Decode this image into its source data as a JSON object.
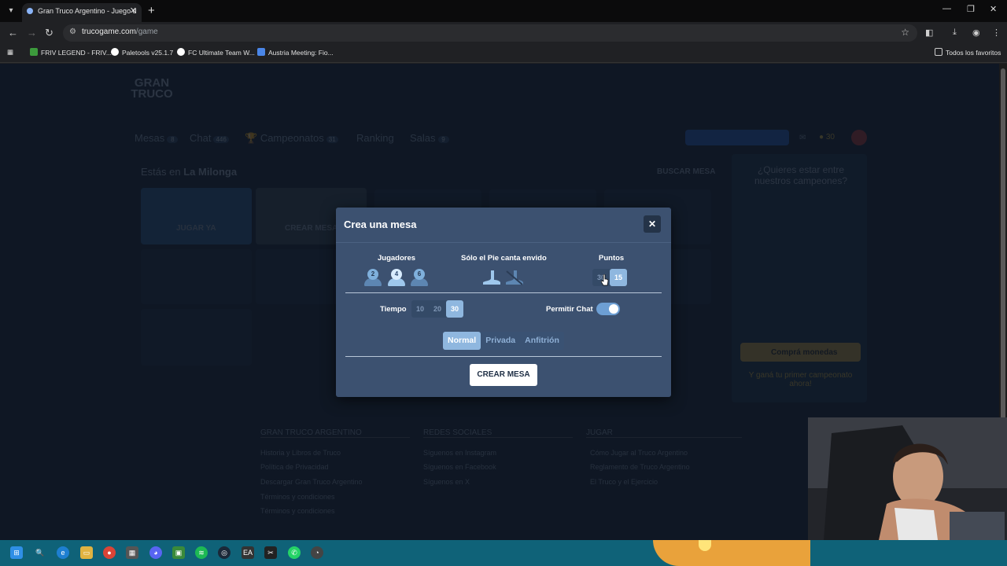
{
  "browser": {
    "tab_title": "Gran Truco Argentino - Juego d",
    "url_host": "trucogame.com",
    "url_path": "/game",
    "bookmarks": [
      "FRIV LEGEND - FRIV...",
      "Paletools v25.1.7",
      "FC Ultimate Team W...",
      "Austria Meeting: Fio..."
    ],
    "all_bookmarks": "Todos los favoritos"
  },
  "background": {
    "logo": "GRAN TRUCO",
    "nav": [
      {
        "label": "Mesas",
        "badge": "8"
      },
      {
        "label": "Chat",
        "badge": "446"
      },
      {
        "label": "Campeonatos",
        "badge": "31"
      },
      {
        "label": "Ranking",
        "badge": ""
      },
      {
        "label": "Salas",
        "badge": "9"
      }
    ],
    "location_prefix": "Estás en ",
    "location_name": "La Milonga",
    "search_table": "BUSCAR MESA",
    "play_now": "JUGAR YA",
    "create_table_bg": "CREAR MESA",
    "champions_title": "¿Quieres estar entre nuestros campeones?",
    "buy_coins": "Comprá monedas",
    "buy_sub": "Y ganá tu primer campeonato ahora!",
    "coins": "30",
    "footer_heads": [
      "GRAN TRUCO ARGENTINO",
      "REDES SOCIALES",
      "JUGAR"
    ],
    "footer_links": [
      [
        "Historia y Libros de Truco",
        "Política de Privacidad",
        "Descargar Gran Truco Argentino",
        "Términos y condiciones",
        "Términos y condiciones"
      ],
      [
        "Síguenos en Instagram",
        "Síguenos en Facebook",
        "Síguenos en X"
      ],
      [
        "Cómo Jugar al Truco Argentino",
        "Reglamento de Truco Argentino",
        "El Truco y el Ejercicio"
      ]
    ]
  },
  "modal": {
    "title": "Crea una mesa",
    "players_label": "Jugadores",
    "players_options": [
      "2",
      "4",
      "6"
    ],
    "players_selected": "4",
    "pie_label": "Sólo el Pie canta envido",
    "points_label": "Puntos",
    "points_options": [
      "30",
      "15"
    ],
    "points_selected": "15",
    "time_label": "Tiempo",
    "time_options": [
      "10",
      "20",
      "30"
    ],
    "time_selected": "30",
    "chat_label": "Permitir Chat",
    "chat_enabled": true,
    "type_options": [
      "Normal",
      "Privada",
      "Anfitrión"
    ],
    "type_selected": "Normal",
    "create_button": "CREAR MESA"
  },
  "colors": {
    "modal_bg": "#3c5170",
    "accent": "#8fb7df",
    "page_bg": "#172233"
  }
}
